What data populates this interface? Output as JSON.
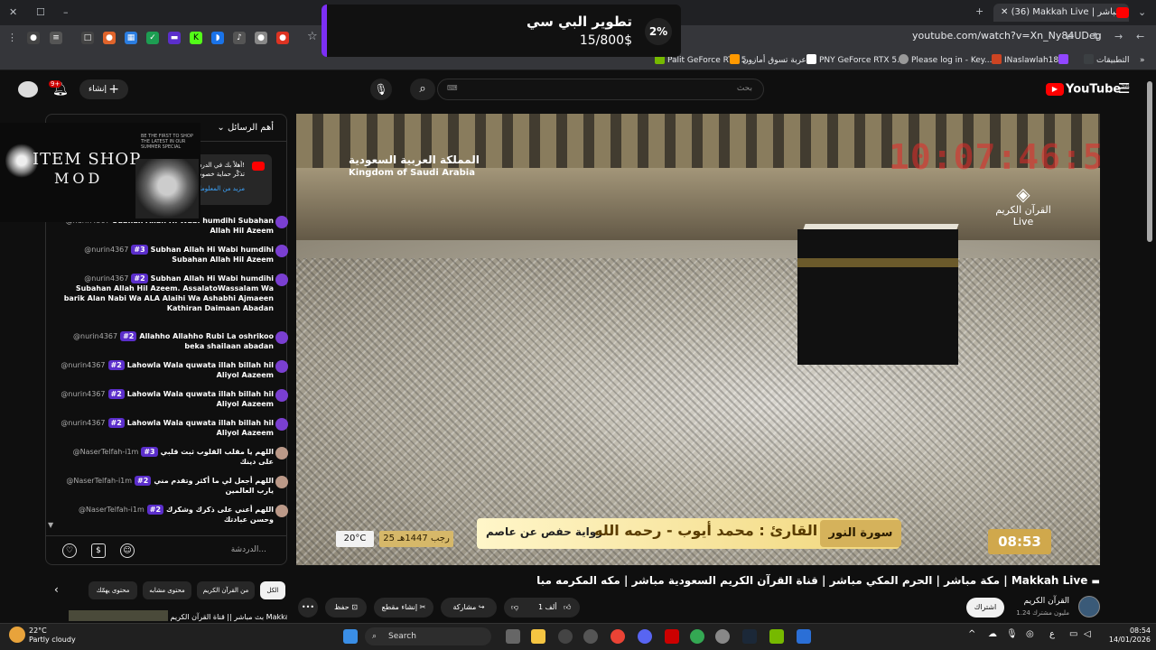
{
  "browser": {
    "tab_title": "Makkah Live | مكة مباشر",
    "tab_count": "(36)",
    "url": "youtube.com/watch?v=Xn_Ny84UDeg",
    "new_tab": "+",
    "bookmarks": [
      "Palit GeForce RTX 5...",
      "عربة تسوق أمازون",
      "PNY GeForce RTX 5...",
      "Please log in - Key...",
      "INaslawlah18",
      "التطبيقات"
    ]
  },
  "popup": {
    "title": "تطوير البي سي",
    "subtitle": "15/800$",
    "percent": "2%"
  },
  "youtube": {
    "logo": "YouTube",
    "region": "SA",
    "search_placeholder": "بحث",
    "create_label": "إنشاء",
    "notif_count": "9+"
  },
  "video": {
    "ksa_ar": "المملكة العربية السعودية",
    "ksa_en": "Kingdom of Saudi Arabia",
    "clock": "10:07:46:57",
    "channel_ar": "القرآن الكريم",
    "channel_en": "Live",
    "surah": "سورة النور",
    "reader": "القارئ : محمد أيوب - رحمه الله",
    "riwaya": "رواية حفص عن عاصم",
    "hijri_date": "25 رجب 1447هـ",
    "temperature": "20°C",
    "time": "08:53"
  },
  "chat": {
    "header": "أهم الرسائل",
    "pinned_line1": "أهلاً بك في الدردشة!",
    "pinned_line2": "تذكّر حماية خصوصيتك",
    "pinned_more": "مزيد من المعلومات",
    "input_placeholder": "الدردشة...",
    "messages": [
      {
        "author": "@nurin4367",
        "badge": "",
        "text": "Subhan Allah Hi Wabi humdihi Subahan Allah Hil Azeem"
      },
      {
        "author": "@nurin4367",
        "badge": "#3",
        "text": "Subhan Allah Hi Wabi humdihi Subahan Allah Hil Azeem"
      },
      {
        "author": "@nurin4367",
        "badge": "#2",
        "text": "Subhan Allah Hi Wabi humdihi Subahan Allah Hil Azeem. AssalatoWassalam Wa barik Alan Nabi Wa ALA Alaihi Wa Ashabhi Ajmaeen Kathiran Daimaan Abadan"
      },
      {
        "author": "@nurin4367",
        "badge": "#2",
        "text": "Allahho Allahho Rubi La oshrikoo beka shailaan abadan"
      },
      {
        "author": "@nurin4367",
        "badge": "#2",
        "text": "Lahowla Wala quwata illah billah hil Aliyol Aazeem"
      },
      {
        "author": "@nurin4367",
        "badge": "#2",
        "text": "Lahowla Wala quwata illah billah hil Aliyol Aazeem"
      },
      {
        "author": "@nurin4367",
        "badge": "#2",
        "text": "Lahowla Wala quwata illah billah hil Aliyol Aazeem"
      },
      {
        "author": "@NaserTelfah-i1m",
        "badge": "#3",
        "text": "اللهم يا مقلب القلوب ثبت قلبي على دينك"
      },
      {
        "author": "@NaserTelfah-i1m",
        "badge": "#2",
        "text": "اللهم أجعل لي ما أكثر وتقدم مني يارب العالمين"
      },
      {
        "author": "@NaserTelfah-i1m",
        "badge": "#2",
        "text": "اللهم أعني على ذكرك وشكرك وحسن عبادتك"
      }
    ]
  },
  "overlay": {
    "title1": "ITEM SHOP",
    "title2": "MOD",
    "tagline": "BE THE FIRST TO SHOP THE LATEST IN OUR SUMMER SPECIAL"
  },
  "below": {
    "title": "مكة مباشر | الحرم المكي مباشر | قناة القرآن الكريم السعودية مباشر | مكه المكرمه مبا | Makkah Live",
    "channel": "القرآن الكريم",
    "subs": "1.24 مليون مشترك",
    "subscribe": "اشتراك",
    "likes": "1 ألف",
    "share": "مشاركة",
    "clip": "إنشاء مقطع",
    "save": "حفظ",
    "more": "•••",
    "chips": [
      "الكل",
      "من القرآن الكريم",
      "محتوى مشابه",
      "محتوى يهمّك"
    ],
    "rec_title": "بث مباشر || قناة القرآن الكريم Makkah"
  },
  "taskbar": {
    "search": "Search",
    "weather_temp": "22°C",
    "weather_desc": "Partly cloudy",
    "time": "08:54",
    "date": "14/01/2026"
  }
}
